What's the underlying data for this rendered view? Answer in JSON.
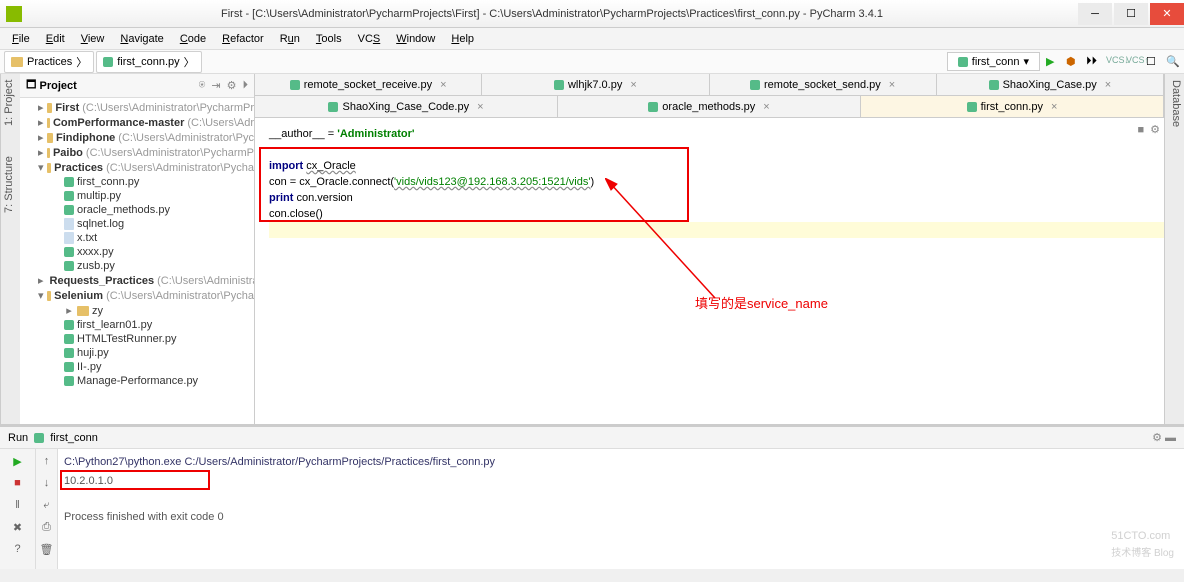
{
  "window": {
    "title": "First - [C:\\Users\\Administrator\\PycharmProjects\\First] - C:\\Users\\Administrator\\PycharmProjects\\Practices\\first_conn.py - PyCharm 3.4.1"
  },
  "menu": [
    "File",
    "Edit",
    "View",
    "Navigate",
    "Code",
    "Refactor",
    "Run",
    "Tools",
    "VCS",
    "Window",
    "Help"
  ],
  "breadcrumbs": {
    "folder": "Practices",
    "file": "first_conn.py"
  },
  "runconfig": {
    "name": "first_conn"
  },
  "sidebar_tabs": {
    "project": "1: Project",
    "structure": "7: Structure",
    "database": "Database"
  },
  "project_panel": {
    "title": "Project"
  },
  "tree": {
    "first": {
      "name": "First",
      "path": "(C:\\Users\\Administrator\\PycharmPr"
    },
    "comperf": {
      "name": "ComPerformance-master",
      "path": "(C:\\Users\\Adr"
    },
    "findiphone": {
      "name": "Findiphone",
      "path": "(C:\\Users\\Administrator\\Pyc"
    },
    "paibo": {
      "name": "Paibo",
      "path": "(C:\\Users\\Administrator\\PycharmP"
    },
    "practices": {
      "name": "Practices",
      "path": "(C:\\Users\\Administrator\\Pycha"
    },
    "practices_files": [
      "first_conn.py",
      "multip.py",
      "oracle_methods.py",
      "sqlnet.log",
      "x.txt",
      "xxxx.py",
      "zusb.py"
    ],
    "requests": {
      "name": "Requests_Practices",
      "path": "(C:\\Users\\Administra"
    },
    "selenium": {
      "name": "Selenium",
      "path": "(C:\\Users\\Administrator\\Pycha"
    },
    "selenium_children": [
      "zy",
      "first_learn01.py",
      "HTMLTestRunner.py",
      "huji.py",
      "II-.py",
      "Manage-Performance.py"
    ]
  },
  "tabs_row1": [
    {
      "label": "remote_socket_receive.py"
    },
    {
      "label": "wlhjk7.0.py"
    },
    {
      "label": "remote_socket_send.py"
    },
    {
      "label": "ShaoXing_Case.py"
    }
  ],
  "tabs_row2": [
    {
      "label": "ShaoXing_Case_Code.py"
    },
    {
      "label": "oracle_methods.py"
    },
    {
      "label": "first_conn.py",
      "active": true
    }
  ],
  "code": {
    "l1a": "__author__ = ",
    "l1b": "'Administrator'",
    "l3a": "import ",
    "l3b": "cx_Oracle",
    "l4a": "con = cx_Oracle.connect(",
    "l4b": "'vids/vids123@192.168.3.205:1521/vids'",
    "l4c": ")",
    "l5a": "print ",
    "l5b": "con.version",
    "l6": "con.close()"
  },
  "annotation": "填写的是service_name",
  "run": {
    "label": "Run",
    "config": "first_conn",
    "cmd": "C:\\Python27\\python.exe C:/Users/Administrator/PycharmProjects/Practices/first_conn.py",
    "out": "10.2.0.1.0",
    "exit": "Process finished with exit code 0"
  },
  "watermark": {
    "main": "51CTO.com",
    "sub": "技术博客  Blog"
  }
}
